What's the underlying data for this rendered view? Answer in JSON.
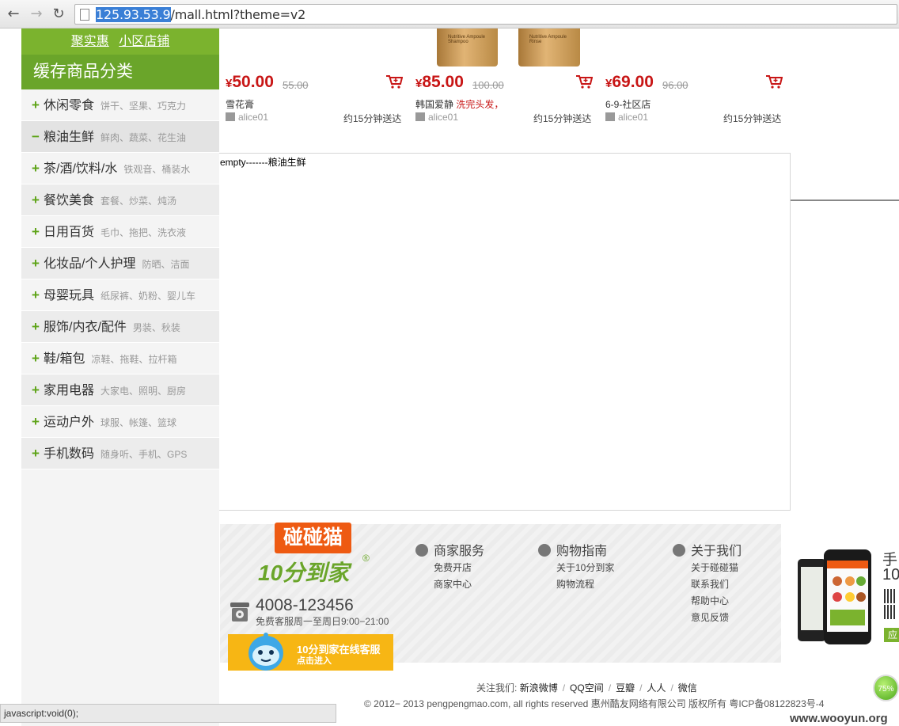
{
  "browser": {
    "url_host": "125.93.53.9",
    "url_path": "/mall.html?theme=v2"
  },
  "sidebar": {
    "top_links": [
      "聚实惠",
      "小区店铺"
    ],
    "header": "缓存商品分类",
    "categories": [
      {
        "name": "休闲零食",
        "sub": "饼干、坚果、巧克力",
        "sign": "+"
      },
      {
        "name": "粮油生鲜",
        "sub": "鲜肉、蔬菜、花生油",
        "sign": "−"
      },
      {
        "name": "茶/酒/饮料/水",
        "sub": "铁观音、桶装水",
        "sign": "+"
      },
      {
        "name": "餐饮美食",
        "sub": "套餐、炒菜、炖汤",
        "sign": "+"
      },
      {
        "name": "日用百货",
        "sub": "毛巾、拖把、洗衣液",
        "sign": "+"
      },
      {
        "name": "化妆品/个人护理",
        "sub": "防晒、洁面",
        "sign": "+"
      },
      {
        "name": "母婴玩具",
        "sub": "纸尿裤、奶粉、婴儿车",
        "sign": "+"
      },
      {
        "name": "服饰/内衣/配件",
        "sub": "男装、秋装",
        "sign": "+"
      },
      {
        "name": "鞋/箱包",
        "sub": "凉鞋、拖鞋、拉杆箱",
        "sign": "+"
      },
      {
        "name": "家用电器",
        "sub": "大家电、照明、厨房",
        "sign": "+"
      },
      {
        "name": "运动户外",
        "sub": "球服、帐篷、篮球",
        "sign": "+"
      },
      {
        "name": "手机数码",
        "sub": "随身听、手机、GPS",
        "sign": "+"
      }
    ]
  },
  "products": [
    {
      "yen": "¥",
      "price": "50.00",
      "old_price": "55.00",
      "name": "雪花膏",
      "promo": "",
      "shop": "alice01",
      "eta": "约15分钟送达"
    },
    {
      "yen": "¥",
      "price": "85.00",
      "old_price": "100.00",
      "name": "韩国爱静 ",
      "promo": "洗完头发，",
      "shop": "alice01",
      "eta": "约15分钟送达"
    },
    {
      "yen": "¥",
      "price": "69.00",
      "old_price": "96.00",
      "name": "6-9-社区店",
      "promo": "",
      "shop": "alice01",
      "eta": "约15分钟送达"
    }
  ],
  "product_image_text": [
    "Nutritive Ampoule Shampoo",
    "Nutritive Ampoule Rinse"
  ],
  "main": {
    "empty_message": "empty-------粮油生鲜"
  },
  "footer": {
    "logo": "碰碰猫",
    "slogan": "10分到家",
    "registered": "®",
    "phone": "4008-123456",
    "hours": "免费客服周一至周日9:00−21:00",
    "cs_title": "10分到家在线客服",
    "cs_sub": "点击进入",
    "columns": [
      {
        "title": "商家服务",
        "links": [
          "免费开店",
          "商家中心"
        ]
      },
      {
        "title": "购物指南",
        "links": [
          "关于10分到家",
          "购物流程"
        ]
      },
      {
        "title": "关于我们",
        "links": [
          "关于碰碰猫",
          "联系我们",
          "帮助中心",
          "意见反馈"
        ]
      }
    ],
    "app_title_1": "手",
    "app_title_2": "10",
    "app_button": "应",
    "follow_label": "关注我们:",
    "social": [
      "新浪微博",
      "QQ空间",
      "豆瓣",
      "人人",
      "微信"
    ],
    "copyright": "© 2012− 2013 pengpengmao.com, all rights reserved 惠州酷友网络有限公司 版权所有 粤ICP备08122823号-4"
  },
  "status_bar": "javascript:void(0);",
  "speed_indicator": "75%",
  "watermark": "www.wooyun.org",
  "colors": {
    "brand_green": "#6aa52a",
    "price_red": "#c81616",
    "logo_orange": "#ee5a12",
    "cs_yellow": "#f7b614"
  }
}
